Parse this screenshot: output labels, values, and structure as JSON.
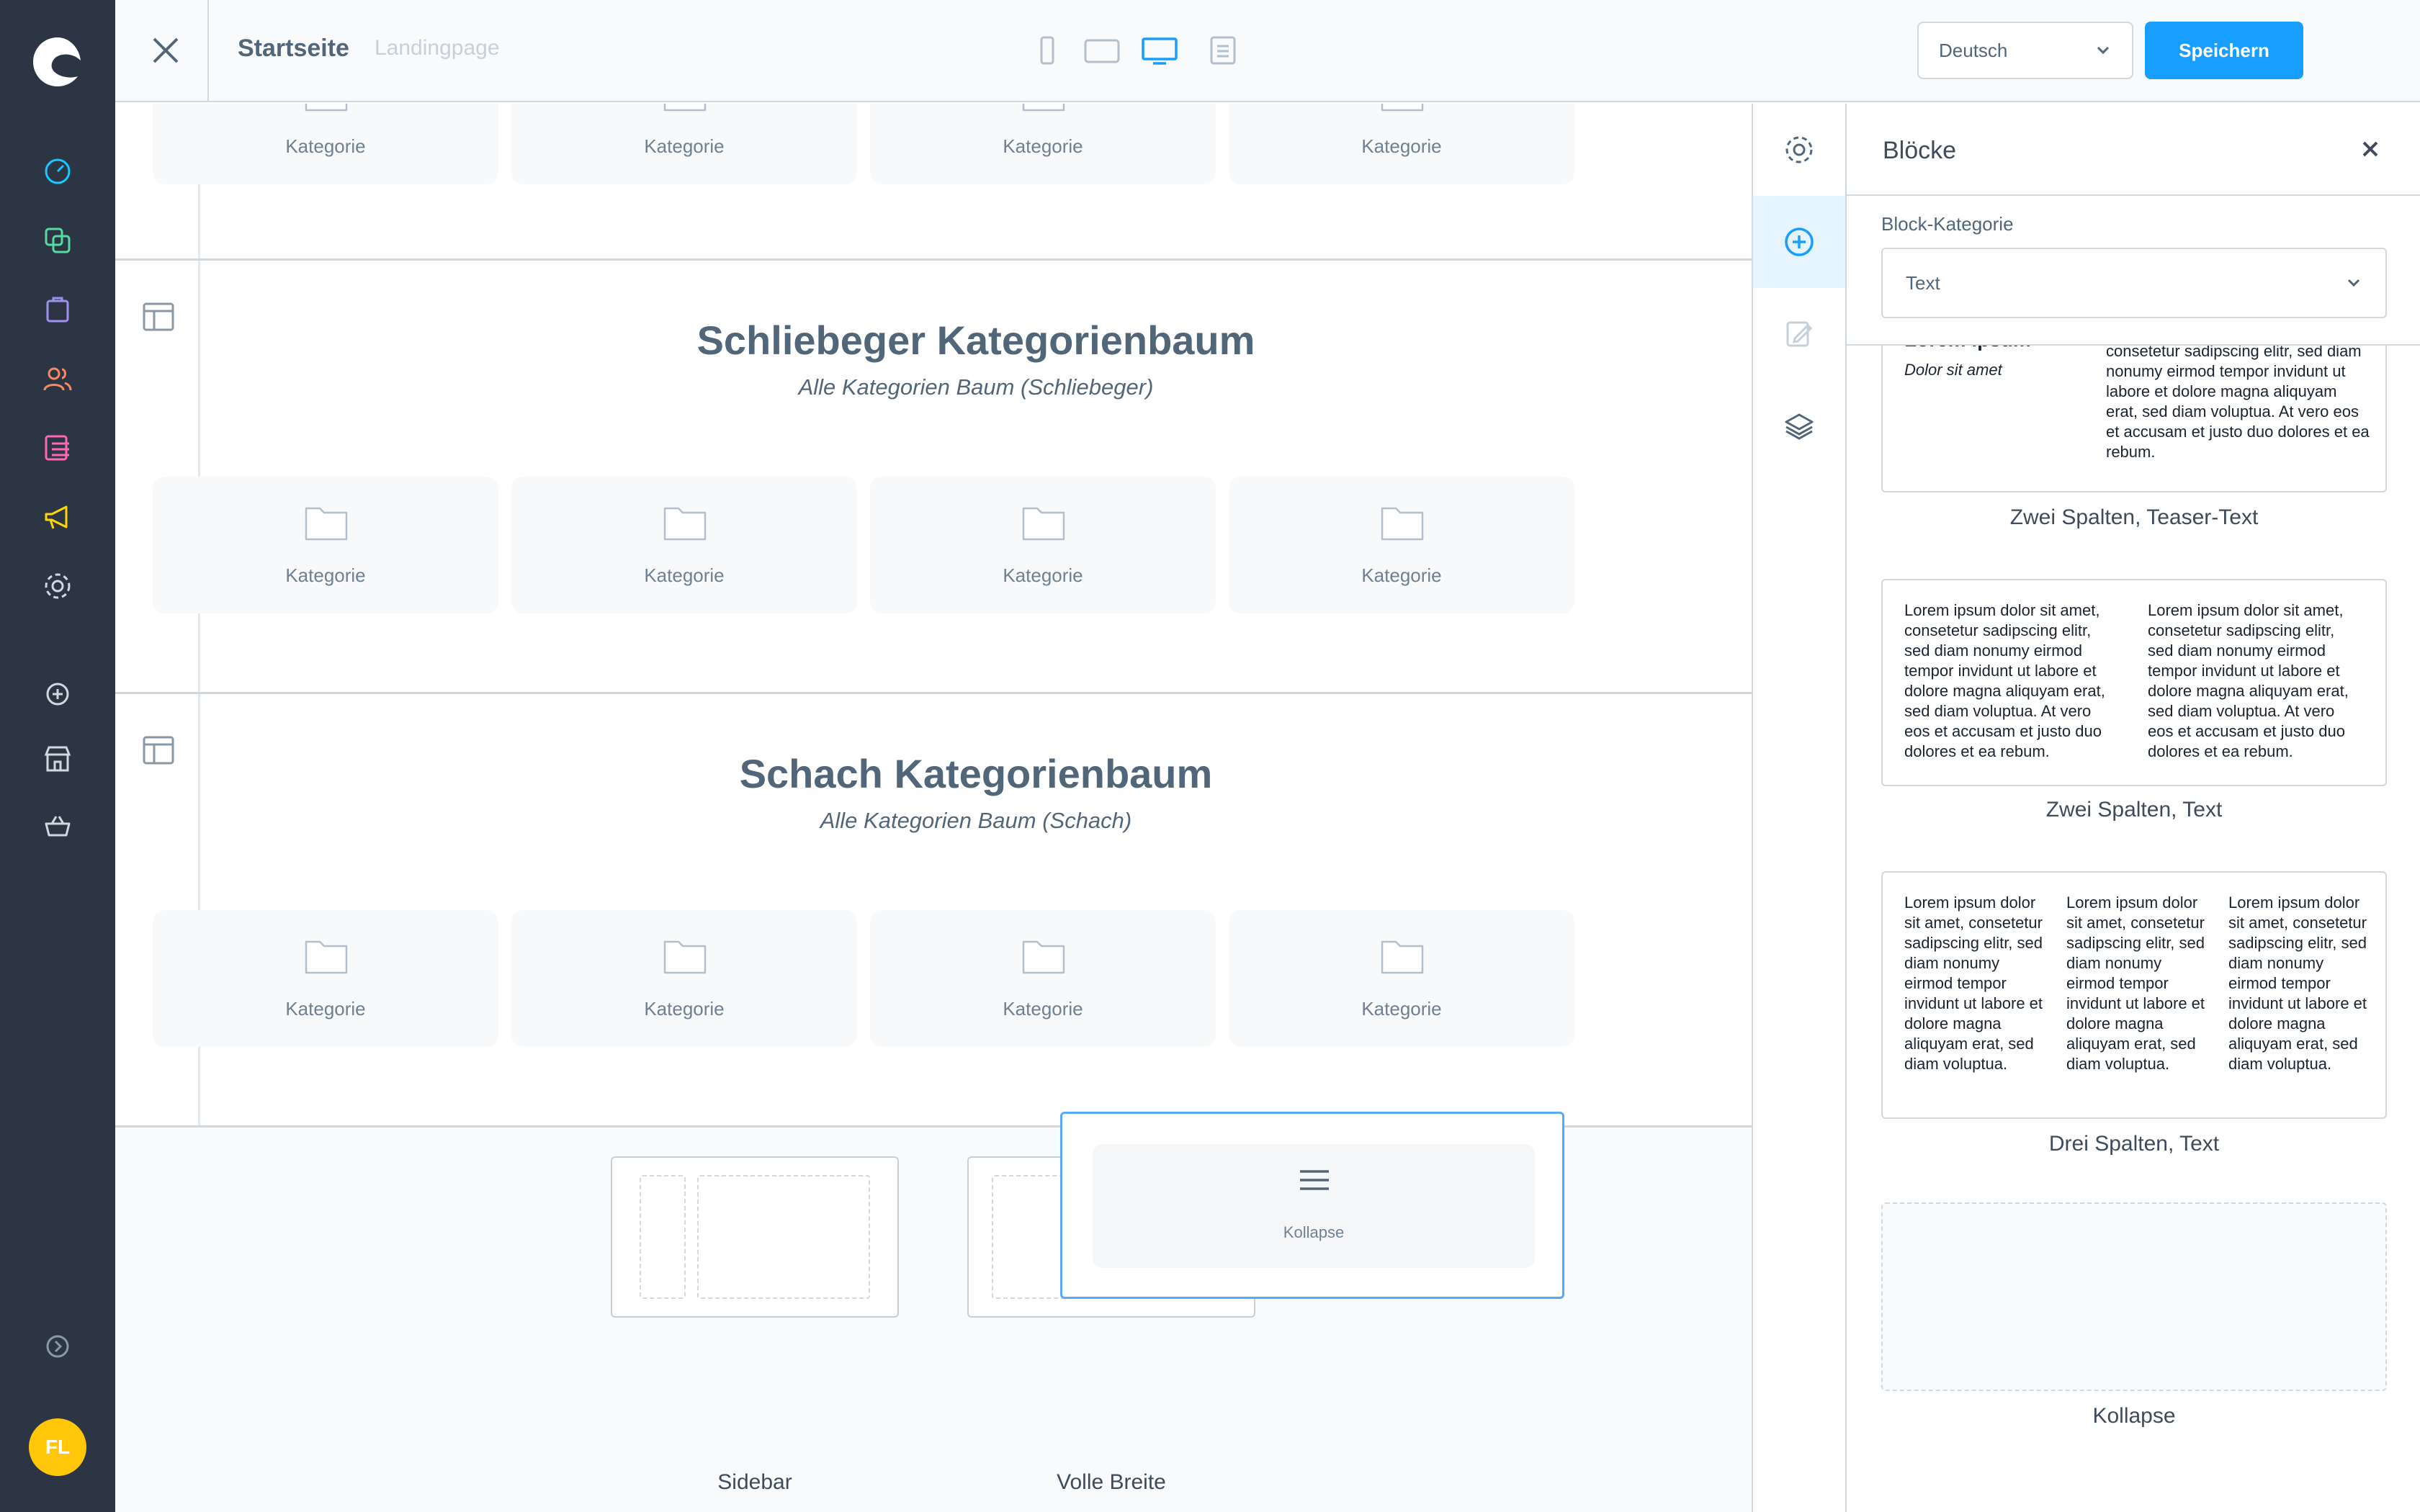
{
  "nav": {
    "avatar_initials": "FL"
  },
  "topbar": {
    "title": "Startseite",
    "subtitle": "Landingpage",
    "language": "Deutsch",
    "save_label": "Speichern"
  },
  "sections": [
    {
      "title": "Schliebeger Kategorienbaum",
      "subtitle": "Alle Kategorien Baum (Schliebeger)",
      "cards": [
        "Kategorie",
        "Kategorie",
        "Kategorie",
        "Kategorie"
      ]
    },
    {
      "title": "Schach Kategorienbaum",
      "subtitle": "Alle Kategorien Baum (Schach)",
      "cards": [
        "Kategorie",
        "Kategorie",
        "Kategorie",
        "Kategorie"
      ]
    }
  ],
  "top_cards": [
    "Kategorie",
    "Kategorie",
    "Kategorie",
    "Kategorie"
  ],
  "picker": {
    "sidebar_label": "Sidebar",
    "fullwidth_label": "Volle Breite",
    "drag_label": "Kollapse"
  },
  "panel": {
    "title": "Blöcke",
    "category_label": "Block-Kategorie",
    "category_value": "Text",
    "blocks": [
      {
        "label": "Zwei Spalten, Teaser-Text",
        "col_heading": "Lorem ipsum",
        "col_sub": "Dolor sit amet",
        "col_text": "consetetur sadipscing elitr, sed diam nonumy eirmod tempor invidunt ut labore et dolore magna aliquyam erat, sed diam voluptua. At vero eos et accusam et justo duo dolores et ea rebum."
      },
      {
        "label": "Zwei Spalten, Text",
        "col1": "Lorem ipsum dolor sit amet, consetetur sadipscing elitr, sed diam nonumy eirmod tempor invidunt ut labore et dolore magna aliquyam erat, sed diam voluptua. At vero eos et accusam et justo duo dolores et ea rebum.",
        "col2": "Lorem ipsum dolor sit amet, consetetur sadipscing elitr, sed diam nonumy eirmod tempor invidunt ut labore et dolore magna aliquyam erat, sed diam voluptua. At vero eos et accusam et justo duo dolores et ea rebum."
      },
      {
        "label": "Drei Spalten, Text",
        "col1": "Lorem ipsum dolor sit amet, consetetur sadipscing elitr, sed diam nonumy eirmod tempor invidunt ut labore et dolore magna aliquyam erat, sed diam voluptua.",
        "col2": "Lorem ipsum dolor sit amet, consetetur sadipscing elitr, sed diam nonumy eirmod tempor invidunt ut labore et dolore magna aliquyam erat, sed diam voluptua.",
        "col3": "Lorem ipsum dolor sit amet, consetetur sadipscing elitr, sed diam nonumy eirmod tempor invidunt ut labore et dolore magna aliquyam erat, sed diam voluptua."
      },
      {
        "label": "Kollapse"
      }
    ]
  },
  "colors": {
    "nav_bg": "#2b3544",
    "accent": "#189eff",
    "avatar": "#ffc60a"
  }
}
